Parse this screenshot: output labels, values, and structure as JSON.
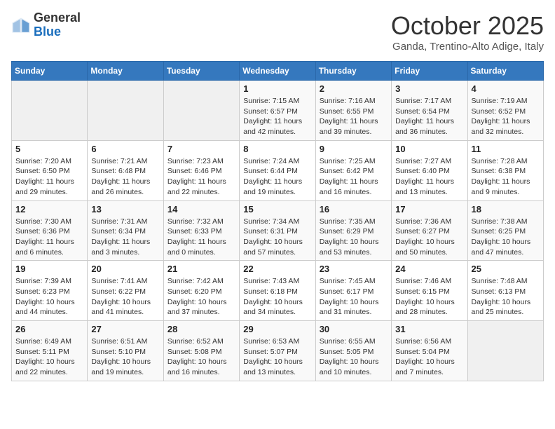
{
  "logo": {
    "general": "General",
    "blue": "Blue"
  },
  "header": {
    "month_title": "October 2025",
    "subtitle": "Ganda, Trentino-Alto Adige, Italy"
  },
  "weekdays": [
    "Sunday",
    "Monday",
    "Tuesday",
    "Wednesday",
    "Thursday",
    "Friday",
    "Saturday"
  ],
  "weeks": [
    [
      {
        "day": "",
        "info": ""
      },
      {
        "day": "",
        "info": ""
      },
      {
        "day": "",
        "info": ""
      },
      {
        "day": "1",
        "info": "Sunrise: 7:15 AM\nSunset: 6:57 PM\nDaylight: 11 hours and 42 minutes."
      },
      {
        "day": "2",
        "info": "Sunrise: 7:16 AM\nSunset: 6:55 PM\nDaylight: 11 hours and 39 minutes."
      },
      {
        "day": "3",
        "info": "Sunrise: 7:17 AM\nSunset: 6:54 PM\nDaylight: 11 hours and 36 minutes."
      },
      {
        "day": "4",
        "info": "Sunrise: 7:19 AM\nSunset: 6:52 PM\nDaylight: 11 hours and 32 minutes."
      }
    ],
    [
      {
        "day": "5",
        "info": "Sunrise: 7:20 AM\nSunset: 6:50 PM\nDaylight: 11 hours and 29 minutes."
      },
      {
        "day": "6",
        "info": "Sunrise: 7:21 AM\nSunset: 6:48 PM\nDaylight: 11 hours and 26 minutes."
      },
      {
        "day": "7",
        "info": "Sunrise: 7:23 AM\nSunset: 6:46 PM\nDaylight: 11 hours and 22 minutes."
      },
      {
        "day": "8",
        "info": "Sunrise: 7:24 AM\nSunset: 6:44 PM\nDaylight: 11 hours and 19 minutes."
      },
      {
        "day": "9",
        "info": "Sunrise: 7:25 AM\nSunset: 6:42 PM\nDaylight: 11 hours and 16 minutes."
      },
      {
        "day": "10",
        "info": "Sunrise: 7:27 AM\nSunset: 6:40 PM\nDaylight: 11 hours and 13 minutes."
      },
      {
        "day": "11",
        "info": "Sunrise: 7:28 AM\nSunset: 6:38 PM\nDaylight: 11 hours and 9 minutes."
      }
    ],
    [
      {
        "day": "12",
        "info": "Sunrise: 7:30 AM\nSunset: 6:36 PM\nDaylight: 11 hours and 6 minutes."
      },
      {
        "day": "13",
        "info": "Sunrise: 7:31 AM\nSunset: 6:34 PM\nDaylight: 11 hours and 3 minutes."
      },
      {
        "day": "14",
        "info": "Sunrise: 7:32 AM\nSunset: 6:33 PM\nDaylight: 11 hours and 0 minutes."
      },
      {
        "day": "15",
        "info": "Sunrise: 7:34 AM\nSunset: 6:31 PM\nDaylight: 10 hours and 57 minutes."
      },
      {
        "day": "16",
        "info": "Sunrise: 7:35 AM\nSunset: 6:29 PM\nDaylight: 10 hours and 53 minutes."
      },
      {
        "day": "17",
        "info": "Sunrise: 7:36 AM\nSunset: 6:27 PM\nDaylight: 10 hours and 50 minutes."
      },
      {
        "day": "18",
        "info": "Sunrise: 7:38 AM\nSunset: 6:25 PM\nDaylight: 10 hours and 47 minutes."
      }
    ],
    [
      {
        "day": "19",
        "info": "Sunrise: 7:39 AM\nSunset: 6:23 PM\nDaylight: 10 hours and 44 minutes."
      },
      {
        "day": "20",
        "info": "Sunrise: 7:41 AM\nSunset: 6:22 PM\nDaylight: 10 hours and 41 minutes."
      },
      {
        "day": "21",
        "info": "Sunrise: 7:42 AM\nSunset: 6:20 PM\nDaylight: 10 hours and 37 minutes."
      },
      {
        "day": "22",
        "info": "Sunrise: 7:43 AM\nSunset: 6:18 PM\nDaylight: 10 hours and 34 minutes."
      },
      {
        "day": "23",
        "info": "Sunrise: 7:45 AM\nSunset: 6:17 PM\nDaylight: 10 hours and 31 minutes."
      },
      {
        "day": "24",
        "info": "Sunrise: 7:46 AM\nSunset: 6:15 PM\nDaylight: 10 hours and 28 minutes."
      },
      {
        "day": "25",
        "info": "Sunrise: 7:48 AM\nSunset: 6:13 PM\nDaylight: 10 hours and 25 minutes."
      }
    ],
    [
      {
        "day": "26",
        "info": "Sunrise: 6:49 AM\nSunset: 5:11 PM\nDaylight: 10 hours and 22 minutes."
      },
      {
        "day": "27",
        "info": "Sunrise: 6:51 AM\nSunset: 5:10 PM\nDaylight: 10 hours and 19 minutes."
      },
      {
        "day": "28",
        "info": "Sunrise: 6:52 AM\nSunset: 5:08 PM\nDaylight: 10 hours and 16 minutes."
      },
      {
        "day": "29",
        "info": "Sunrise: 6:53 AM\nSunset: 5:07 PM\nDaylight: 10 hours and 13 minutes."
      },
      {
        "day": "30",
        "info": "Sunrise: 6:55 AM\nSunset: 5:05 PM\nDaylight: 10 hours and 10 minutes."
      },
      {
        "day": "31",
        "info": "Sunrise: 6:56 AM\nSunset: 5:04 PM\nDaylight: 10 hours and 7 minutes."
      },
      {
        "day": "",
        "info": ""
      }
    ]
  ]
}
